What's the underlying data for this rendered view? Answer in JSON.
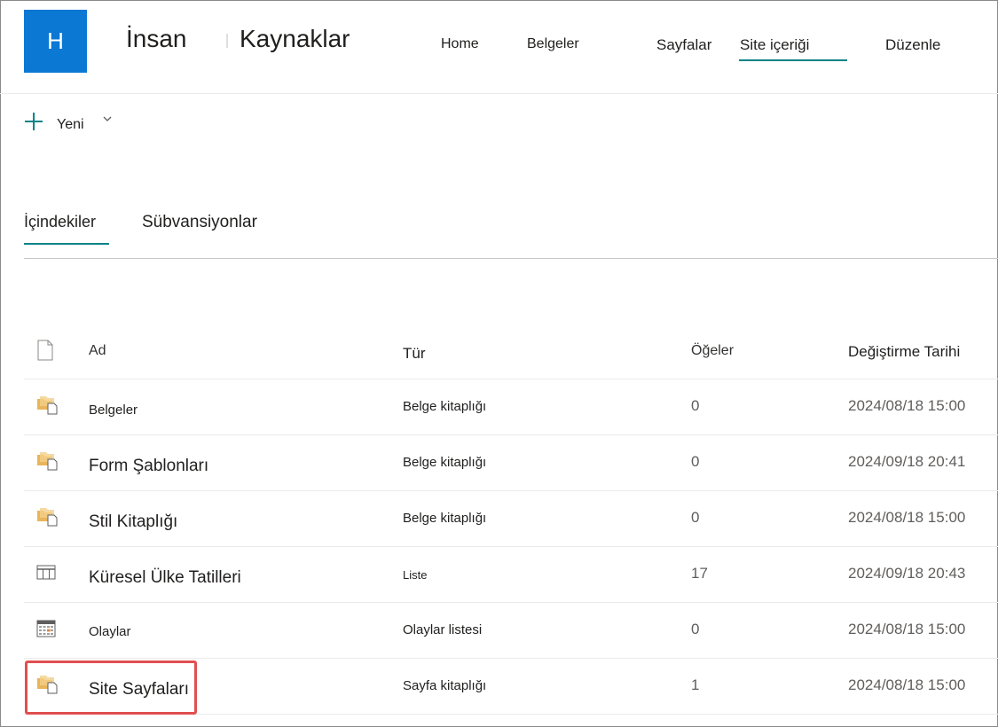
{
  "site": {
    "logo_letter": "H",
    "title_part1": "İnsan",
    "title_part2": "Kaynaklar"
  },
  "nav": {
    "items": [
      {
        "label": "Home"
      },
      {
        "label": "Belgeler"
      },
      {
        "label": "Sayfalar"
      },
      {
        "label": "Site içeriği"
      },
      {
        "label": "Düzenle"
      }
    ],
    "active": "Site içeriği"
  },
  "command_bar": {
    "new_label": "Yeni",
    "new_icon": "plus-icon",
    "dropdown_icon": "chevron-down-icon"
  },
  "tabs": [
    {
      "label": "İçindekiler",
      "selected": true
    },
    {
      "label": "Sübvansiyonlar",
      "selected": false
    }
  ],
  "table": {
    "columns": {
      "icon": "file-type-icon",
      "name": "Ad",
      "type": "Tür",
      "items": "Öğeler",
      "modified": "Değiştirme Tarihi"
    },
    "rows": [
      {
        "icon": "document-library-icon",
        "name": "Belgeler",
        "type": "Belge kitaplığı",
        "items": "0",
        "modified": "2024/08/18 15:00"
      },
      {
        "icon": "document-library-icon",
        "name": "Form Şablonları",
        "type": "Belge kitaplığı",
        "items": "0",
        "modified": "2024/09/18 20:41"
      },
      {
        "icon": "document-library-icon",
        "name": "Stil Kitaplığı",
        "type": "Belge kitaplığı",
        "items": "0",
        "modified": "2024/08/18 15:00"
      },
      {
        "icon": "list-icon",
        "name": "Küresel Ülke Tatilleri",
        "type": "Liste",
        "items": "17",
        "modified": "2024/09/18 20:43"
      },
      {
        "icon": "calendar-icon",
        "name": "Olaylar",
        "type": "Olaylar listesi",
        "items": "0",
        "modified": "2024/08/18 15:00"
      },
      {
        "icon": "document-library-icon",
        "name": "Site Sayfaları",
        "type": "Sayfa kitaplığı",
        "items": "1",
        "modified": "2024/08/18 15:00"
      }
    ]
  },
  "colors": {
    "accent": "#038387",
    "logo_bg": "#0b78d4",
    "highlight": "#e04f4f",
    "library_icon": "#e8b55a"
  }
}
